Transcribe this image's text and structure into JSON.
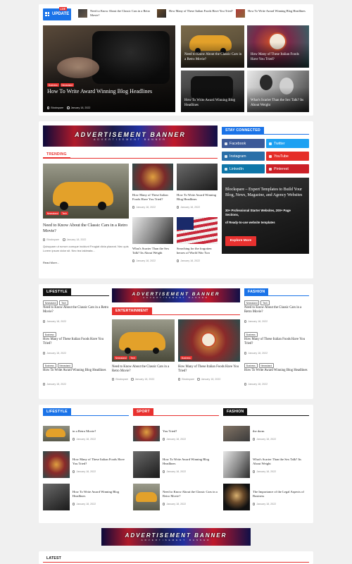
{
  "ticker": {
    "live_label": "LIVE",
    "update_label": "UPDATE",
    "items": [
      {
        "text": "Need to Know About the Classic Cars in a Retro Movie?"
      },
      {
        "text": "How Many of These Italian Foods Have You Tried?"
      },
      {
        "text": "How To Write Award Winning Blog Headlines"
      }
    ]
  },
  "hero": {
    "main": {
      "tags": [
        "Business",
        "Newsstand"
      ],
      "title": "How To Write Award Winning Blog Headlines",
      "author": "Blockspare",
      "date": "January 18, 2022"
    },
    "grid": [
      {
        "title": "Need to Know About the Classic Cars in a Retro Movie?"
      },
      {
        "title": "How Many of These Italian Foods Have You Tried?"
      },
      {
        "title": "How To Write Award Winning Blog Headlines"
      },
      {
        "title": "What's Scarier Than the Sex Talk? Its About Weight"
      }
    ]
  },
  "ad_banner": {
    "title": "ADVERTISEMENT BANNER",
    "subtitle": "ADVERTISEMENT BANNER"
  },
  "trending": {
    "heading": "TRENDING",
    "main": {
      "tags": [
        "Newsstand",
        "Tech"
      ],
      "title": "Need to Know About the Classic Cars in a Retro Movie?",
      "author": "Blockspare",
      "date": "January 18, 2022",
      "excerpt": "Quisquam ut rurrum cumque incidunt Feugiat dicta placeat. Nec quis Lorem ipsum dolor sit. Nec tea takimata...",
      "read_more": "Read More..."
    },
    "items": [
      {
        "title": "How Many of These Italian Foods Have You Tried?",
        "date": "January 18, 2022"
      },
      {
        "title": "How To Write Award Winning Blog Headlines",
        "date": "January 18, 2022"
      },
      {
        "title": "What's Scarier Than the Sex Talk? Its About Weight",
        "date": "January 18, 2022"
      },
      {
        "title": "Searching for the forgotten heroes of World War Two",
        "date": "January 18, 2022"
      }
    ]
  },
  "stay_connected": {
    "heading": "STAY CONNECTED",
    "buttons": [
      {
        "label": "Facebook",
        "color": "#3b5998"
      },
      {
        "label": "Twitter",
        "color": "#1da1f2"
      },
      {
        "label": "Instagram",
        "color": "#2a6fa8"
      },
      {
        "label": "YouTube",
        "color": "#e52d27"
      },
      {
        "label": "LinkedIn",
        "color": "#0e76a8"
      },
      {
        "label": "Pinterest",
        "color": "#cb2027"
      }
    ]
  },
  "promo": {
    "title": "Blockspare – Expert Templates to Build Your Blog, News, Magazine, and Agency Websites",
    "text1": "30+ Professional Starter Websites, 200+ Page Sections,",
    "text2": "of Ready-to-use website templates",
    "button": "Explore More"
  },
  "lifestyle": {
    "heading": "LIFESTYLE",
    "items": [
      {
        "tags": [
          "Newsstand",
          "Tech"
        ],
        "title": "Need to Know About the Classic Cars in a Retro Movie?",
        "date": "January 18, 2022"
      },
      {
        "tags": [
          "Business"
        ],
        "title": "How Many of These Italian Foods Have You Tried?",
        "date": "January 18, 2022"
      },
      {
        "tags": [
          "Business",
          "Newsstand"
        ],
        "title": "How To Write Award Winning Blog Headlines",
        "date": "January 18, 2022"
      }
    ]
  },
  "entertainment": {
    "heading": "ENTERTAINMENT",
    "items": [
      {
        "tags": [
          "Newsstand",
          "Tech"
        ],
        "title": "Need to Know About the Classic Cars in a Retro Movie?",
        "author": "Blockspare",
        "date": "January 18, 2022"
      },
      {
        "tags": [
          "Business"
        ],
        "title": "How Many of These Italian Foods Have You Tried?",
        "author": "Blockspare",
        "date": "January 18, 2022"
      }
    ]
  },
  "fashion": {
    "heading": "FASHION",
    "items": [
      {
        "tags": [
          "Newsstand",
          "Tech"
        ],
        "title": "Need to Know About the Classic Cars in a Retro Movie?",
        "date": "January 18, 2022"
      },
      {
        "tags": [
          "Business"
        ],
        "title": "How Many of These Italian Foods Have You Tried?",
        "date": "January 18, 2022"
      },
      {
        "tags": [
          "Business",
          "Newsstand"
        ],
        "title": "How To Write Award Winning Blog Headlines",
        "date": "January 18, 2022"
      }
    ]
  },
  "col_lifestyle": {
    "heading": "LIFESTYLE",
    "items": [
      {
        "title": "in a Retro Movie?",
        "date": "January 18, 2022"
      },
      {
        "title": "How Many of These Italian Foods Have You Tried?",
        "date": "January 18, 2022"
      },
      {
        "title": "How To Write Award Winning Blog Headlines",
        "date": "January 18, 2022"
      }
    ]
  },
  "col_sport": {
    "heading": "SPORT",
    "items": [
      {
        "title": "You Tried?",
        "date": "January 18, 2022"
      },
      {
        "title": "How To Write Award Winning Blog Headlines",
        "date": "January 18, 2022"
      },
      {
        "title": "Need to Know About the Classic Cars in a Retro Movie?",
        "date": "January 18, 2022"
      }
    ]
  },
  "col_fashion": {
    "heading": "FASHION",
    "items": [
      {
        "title": "the dorm",
        "date": "January 18, 2022"
      },
      {
        "title": "What's Scarier Than the Sex Talk? Its About Weight",
        "date": "January 18, 2022"
      },
      {
        "title": "The Importance of the Legal Aspects of Business",
        "date": "January 18, 2022"
      }
    ]
  },
  "latest": {
    "heading": "LATEST"
  },
  "colors": {
    "accent_red": "#e8312f",
    "accent_blue": "#1a73e8",
    "dark": "#111111"
  }
}
